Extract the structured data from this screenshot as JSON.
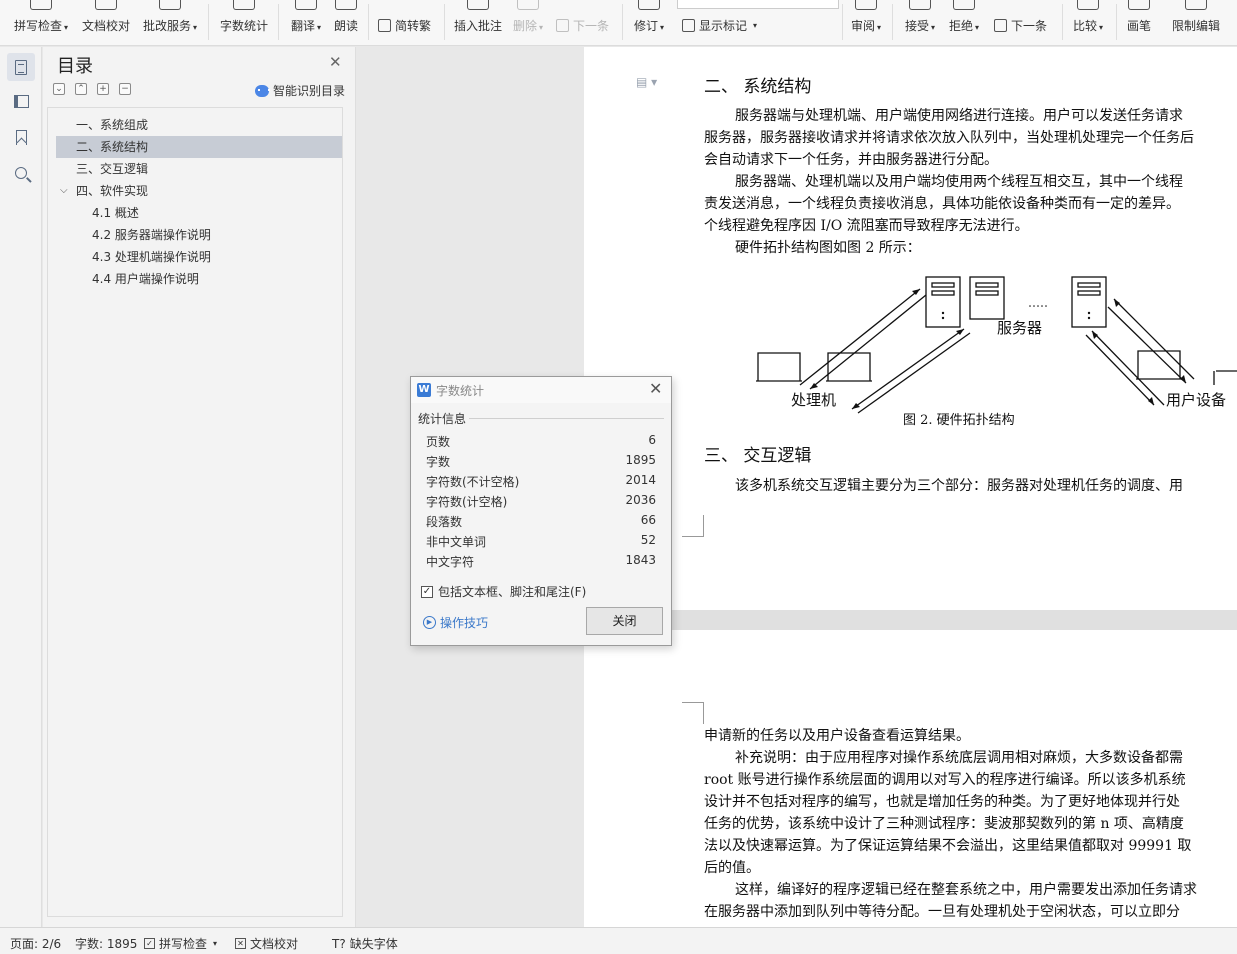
{
  "ribbon": {
    "items": [
      {
        "label": "拼写检查",
        "caret": "▾"
      },
      {
        "label": "文档校对",
        "caret": ""
      },
      {
        "label": "批改服务",
        "caret": "▾"
      },
      {
        "label": "字数统计",
        "caret": ""
      },
      {
        "label": "翻译",
        "caret": "▾"
      },
      {
        "label": "朗读",
        "caret": ""
      },
      {
        "label": "插入批注",
        "caret": ""
      },
      {
        "label": "删除",
        "caret": "▾"
      },
      {
        "label": "修订",
        "caret": "▾"
      },
      {
        "label": "审阅",
        "caret": "▾"
      },
      {
        "label": "接受",
        "caret": "▾"
      },
      {
        "label": "拒绝",
        "caret": "▾"
      },
      {
        "label": "比较",
        "caret": "▾"
      },
      {
        "label": "画笔",
        "caret": ""
      },
      {
        "label": "限制编辑",
        "caret": ""
      }
    ],
    "simp_trad": "简转繁",
    "next_comment": "下一条",
    "show_markup": "显示标记",
    "next_change": "下一条"
  },
  "toc": {
    "title": "目录",
    "smart_label": "智能识别目录",
    "items": [
      {
        "label": "一、系统组成"
      },
      {
        "label": "二、系统结构"
      },
      {
        "label": "三、交互逻辑"
      },
      {
        "label": "四、软件实现"
      },
      {
        "label": "4.1 概述"
      },
      {
        "label": "4.2 服务器端操作说明"
      },
      {
        "label": "4.3 处理机端操作说明"
      },
      {
        "label": "4.4 用户端操作说明"
      }
    ]
  },
  "document": {
    "heading2": "二、 系统结构",
    "p1": [
      "服务器端与处理机端、用户端使用网络进行连接。用户可以发送任务请求",
      "服务器，服务器接收请求并将请求依次放入队列中，当处理机处理完一个任务后",
      "会自动请求下一个任务，并由服务器进行分配。"
    ],
    "p2": [
      "服务器端、处理机端以及用户端均使用两个线程互相交互，其中一个线程",
      "责发送消息，一个线程负责接收消息，具体功能依设备种类而有一定的差异。",
      "个线程避免程序因 I/O 流阻塞而导致程序无法进行。"
    ],
    "p3": "硬件拓扑结构图如图 2 所示：",
    "figure": {
      "server_label": "服务器",
      "processor_label": "处理机",
      "user_label": "用户设备",
      "caption": "图 2. 硬件拓扑结构"
    },
    "heading3": "三、 交互逻辑",
    "p4": "该多机系统交互逻辑主要分为三个部分：服务器对处理机任务的调度、用",
    "page2_lines": [
      "申请新的任务以及用户设备查看运算结果。",
      "补充说明：由于应用程序对操作系统底层调用相对麻烦，大多数设备都需",
      "root 账号进行操作系统层面的调用以对写入的程序进行编译。所以该多机系统",
      "设计并不包括对程序的编写，也就是增加任务的种类。为了更好地体现并行处",
      "任务的优势，该系统中设计了三种测试程序：斐波那契数列的第 n 项、高精度",
      "法以及快速幂运算。为了保证运算结果不会溢出，这里结果值都取对 99991 取",
      "后的值。",
      "这样，编译好的程序逻辑已经在整套系统之中，用户需要发出添加任务请求",
      "在服务器中添加到队列中等待分配。一旦有处理机处于空闲状态，可以立即分"
    ]
  },
  "dialog": {
    "title": "字数统计",
    "group_title": "统计信息",
    "stats": [
      {
        "label": "页数",
        "value": "6"
      },
      {
        "label": "字数",
        "value": "1895"
      },
      {
        "label": "字符数(不计空格)",
        "value": "2014"
      },
      {
        "label": "字符数(计空格)",
        "value": "2036"
      },
      {
        "label": "段落数",
        "value": "66"
      },
      {
        "label": "非中文单词",
        "value": "52"
      },
      {
        "label": "中文字符",
        "value": "1843"
      }
    ],
    "checkbox_label": "包括文本框、脚注和尾注(F)",
    "checkbox_checked": true,
    "tips_label": "操作技巧",
    "close_label": "关闭"
  },
  "status": {
    "page": "页面: 2/6",
    "words": "字数: 1895",
    "spell": "拼写检查",
    "proof": "文档校对",
    "missing_font": "缺失字体"
  }
}
